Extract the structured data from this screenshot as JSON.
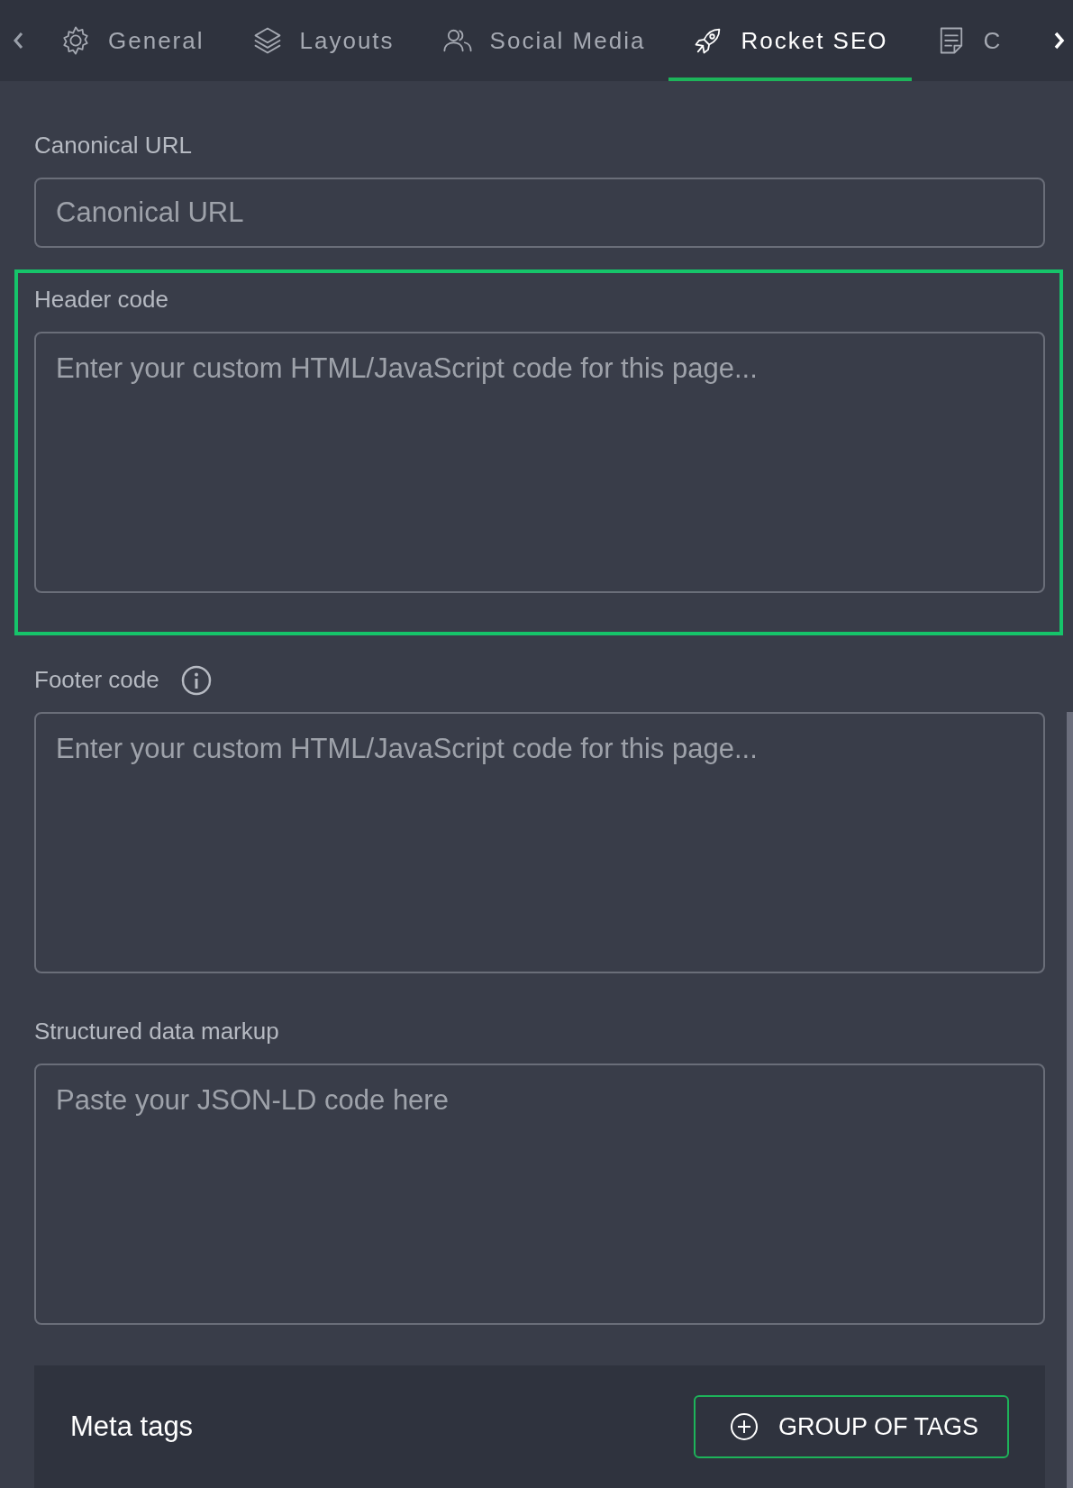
{
  "tabs": [
    {
      "label": "General",
      "selected": false
    },
    {
      "label": "Layouts",
      "selected": false
    },
    {
      "label": "Social Media",
      "selected": false
    },
    {
      "label": "Rocket SEO",
      "selected": true
    },
    {
      "label": "C",
      "selected": false
    }
  ],
  "fields": [
    {
      "kind": "input",
      "label": "Canonical URL",
      "placeholder": "Canonical URL",
      "highlighted": false,
      "info": false
    },
    {
      "kind": "textarea",
      "label": "Header code",
      "placeholder": "Enter your custom HTML/JavaScript code for this page...",
      "highlighted": true,
      "info": false
    },
    {
      "kind": "textarea",
      "label": "Footer code",
      "placeholder": "Enter your custom HTML/JavaScript code for this page...",
      "highlighted": false,
      "info": true
    },
    {
      "kind": "textarea",
      "label": "Structured data markup",
      "placeholder": "Paste your JSON-LD code here",
      "highlighted": false,
      "info": false
    }
  ],
  "meta_tags": {
    "title": "Meta tags",
    "button": "GROUP OF TAGS"
  }
}
